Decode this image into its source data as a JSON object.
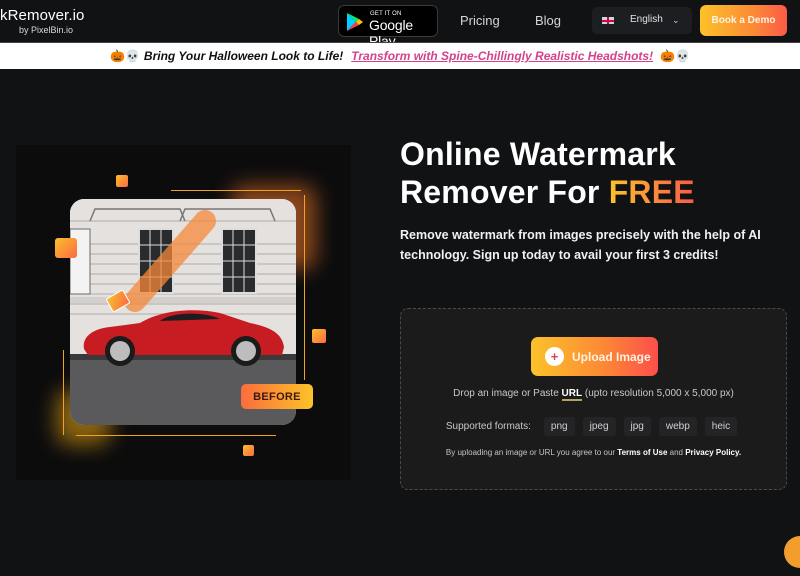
{
  "navbar": {
    "logo_text": "kRemover",
    "logo_tld": ".io",
    "logo_sub": "by PixelBin.io",
    "google_play": {
      "small": "GET IT ON",
      "big": "Google Play"
    },
    "links": [
      "Pricing",
      "Blog"
    ],
    "language": {
      "flag": "uk-flag",
      "label": "English"
    },
    "cta": "Book a Demo"
  },
  "banner": {
    "emoji_left": "🎃💀",
    "text": "Bring Your Halloween Look to Life!",
    "link": "Transform with Spine-Chillingly Realistic Headshots!",
    "emoji_right": "🎃💀"
  },
  "illustration": {
    "tag": "BEFORE",
    "subject": "red sports car in front of building with watermark brush stroke"
  },
  "hero": {
    "title_line1": "Online Watermark",
    "title_line2_prefix": "Remover For ",
    "title_highlight": "FREE",
    "description": "Remove watermark from images precisely with the help of AI technology. Sign up today to avail your first 3 credits!"
  },
  "upload": {
    "button": "Upload Image",
    "drop_prefix": "Drop an image or Paste ",
    "drop_url": "URL",
    "drop_suffix": " (upto resolution 5,000 x 5,000 px)",
    "formats_label": "Supported formats:",
    "formats": [
      "png",
      "jpeg",
      "jpg",
      "webp",
      "heic"
    ],
    "terms_prefix": "By uploading an image or URL you agree to our ",
    "terms_link": "Terms of Use",
    "terms_and": " and ",
    "privacy_link": "Privacy Policy."
  },
  "colors": {
    "background": "#111214",
    "accent_start": "#fcc22a",
    "accent_end": "#fb5a48",
    "banner_link": "#d3428a"
  }
}
